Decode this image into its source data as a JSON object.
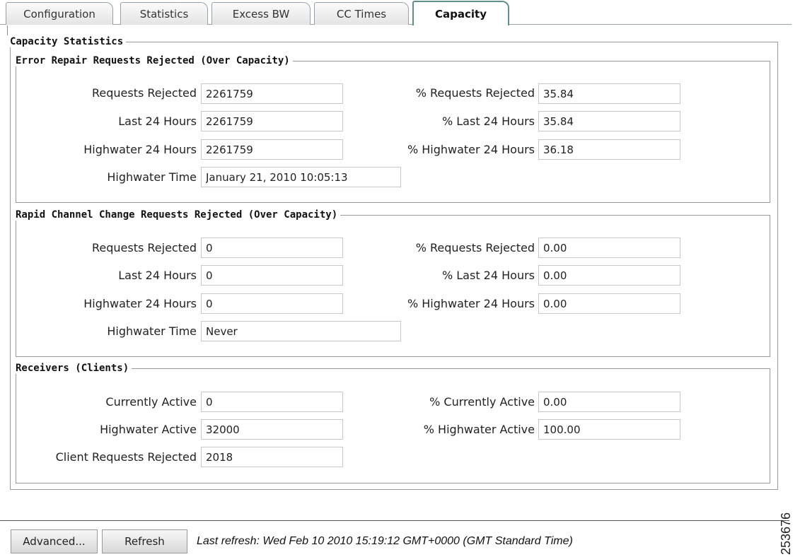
{
  "tabs": [
    {
      "label": "Configuration"
    },
    {
      "label": "Statistics"
    },
    {
      "label": "Excess BW"
    },
    {
      "label": "CC Times"
    },
    {
      "label": "Capacity"
    }
  ],
  "active_tab": "Capacity",
  "capacity_statistics": {
    "legend": "Capacity Statistics",
    "error_repair": {
      "legend": "Error Repair Requests Rejected (Over Capacity)",
      "requests_rejected": {
        "label": "Requests Rejected",
        "value": "2261759"
      },
      "last_24_hours": {
        "label": "Last 24 Hours",
        "value": "2261759"
      },
      "highwater_24_hours": {
        "label": "Highwater 24 Hours",
        "value": "2261759"
      },
      "highwater_time": {
        "label": "Highwater Time",
        "value": "January 21, 2010 10:05:13"
      },
      "pct_requests_rejected": {
        "label": "% Requests Rejected",
        "value": "35.84"
      },
      "pct_last_24_hours": {
        "label": "% Last 24 Hours",
        "value": "35.84"
      },
      "pct_highwater_24_hours": {
        "label": "% Highwater 24 Hours",
        "value": "36.18"
      }
    },
    "rapid_channel_change": {
      "legend": "Rapid Channel Change Requests Rejected (Over Capacity)",
      "requests_rejected": {
        "label": "Requests Rejected",
        "value": "0"
      },
      "last_24_hours": {
        "label": "Last 24 Hours",
        "value": "0"
      },
      "highwater_24_hours": {
        "label": "Highwater 24 Hours",
        "value": "0"
      },
      "highwater_time": {
        "label": "Highwater Time",
        "value": "Never"
      },
      "pct_requests_rejected": {
        "label": "% Requests Rejected",
        "value": "0.00"
      },
      "pct_last_24_hours": {
        "label": "% Last 24 Hours",
        "value": "0.00"
      },
      "pct_highwater_24_hours": {
        "label": "% Highwater 24 Hours",
        "value": "0.00"
      }
    },
    "receivers": {
      "legend": "Receivers (Clients)",
      "currently_active": {
        "label": "Currently Active",
        "value": "0"
      },
      "highwater_active": {
        "label": "Highwater Active",
        "value": "32000"
      },
      "client_requests_rejected": {
        "label": "Client Requests Rejected",
        "value": "2018"
      },
      "pct_currently_active": {
        "label": "% Currently Active",
        "value": "0.00"
      },
      "pct_highwater_active": {
        "label": "% Highwater Active",
        "value": "100.00"
      }
    }
  },
  "footer": {
    "advanced_label": "Advanced...",
    "refresh_label": "Refresh",
    "last_refresh": "Last refresh:  Wed Feb 10 2010 15:19:12 GMT+0000 (GMT Standard Time)"
  },
  "figure_number": "253676"
}
